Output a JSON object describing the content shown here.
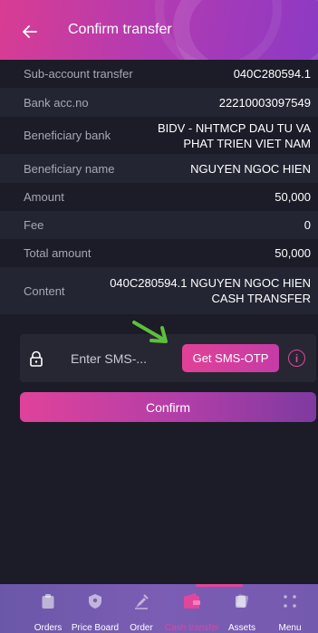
{
  "header": {
    "title": "Confirm transfer"
  },
  "details": [
    {
      "label": "Sub-account transfer",
      "value": "040C280594.1"
    },
    {
      "label": "Bank acc.no",
      "value": "22210003097549"
    },
    {
      "label": "Beneficiary bank",
      "value_line1": "BIDV - NHTMCP DAU TU VA",
      "value_line2": "PHAT TRIEN VIET NAM"
    },
    {
      "label": "Beneficiary name",
      "value": "NGUYEN NGOC HIEN"
    },
    {
      "label": "Amount",
      "value": "50,000"
    },
    {
      "label": "Fee",
      "value": "0"
    },
    {
      "label": "Total amount",
      "value": "50,000"
    },
    {
      "label": "Content",
      "value_line1": "040C280594.1 NGUYEN NGOC HIEN",
      "value_line2": "CASH TRANSFER"
    }
  ],
  "otp": {
    "placeholder": "Enter SMS-...",
    "button_label": "Get SMS-OTP",
    "info_symbol": "i"
  },
  "confirm_label": "Confirm",
  "nav": {
    "active_index": 4,
    "items": [
      {
        "label": "Orders",
        "icon": "orders-icon"
      },
      {
        "label": "Price Board",
        "icon": "price-board-icon"
      },
      {
        "label": "Order",
        "icon": "order-icon"
      },
      {
        "label": "Cash transfer",
        "icon": "cash-transfer-icon"
      },
      {
        "label": "Assets",
        "icon": "assets-icon"
      },
      {
        "label": "Menu",
        "icon": "menu-icon"
      }
    ]
  },
  "colors": {
    "background": "#1b1c27",
    "accent": "#e0479b",
    "row_alt": "#242533",
    "nav": "#7b5db4",
    "annotation_arrow": "#5fbf3a"
  }
}
